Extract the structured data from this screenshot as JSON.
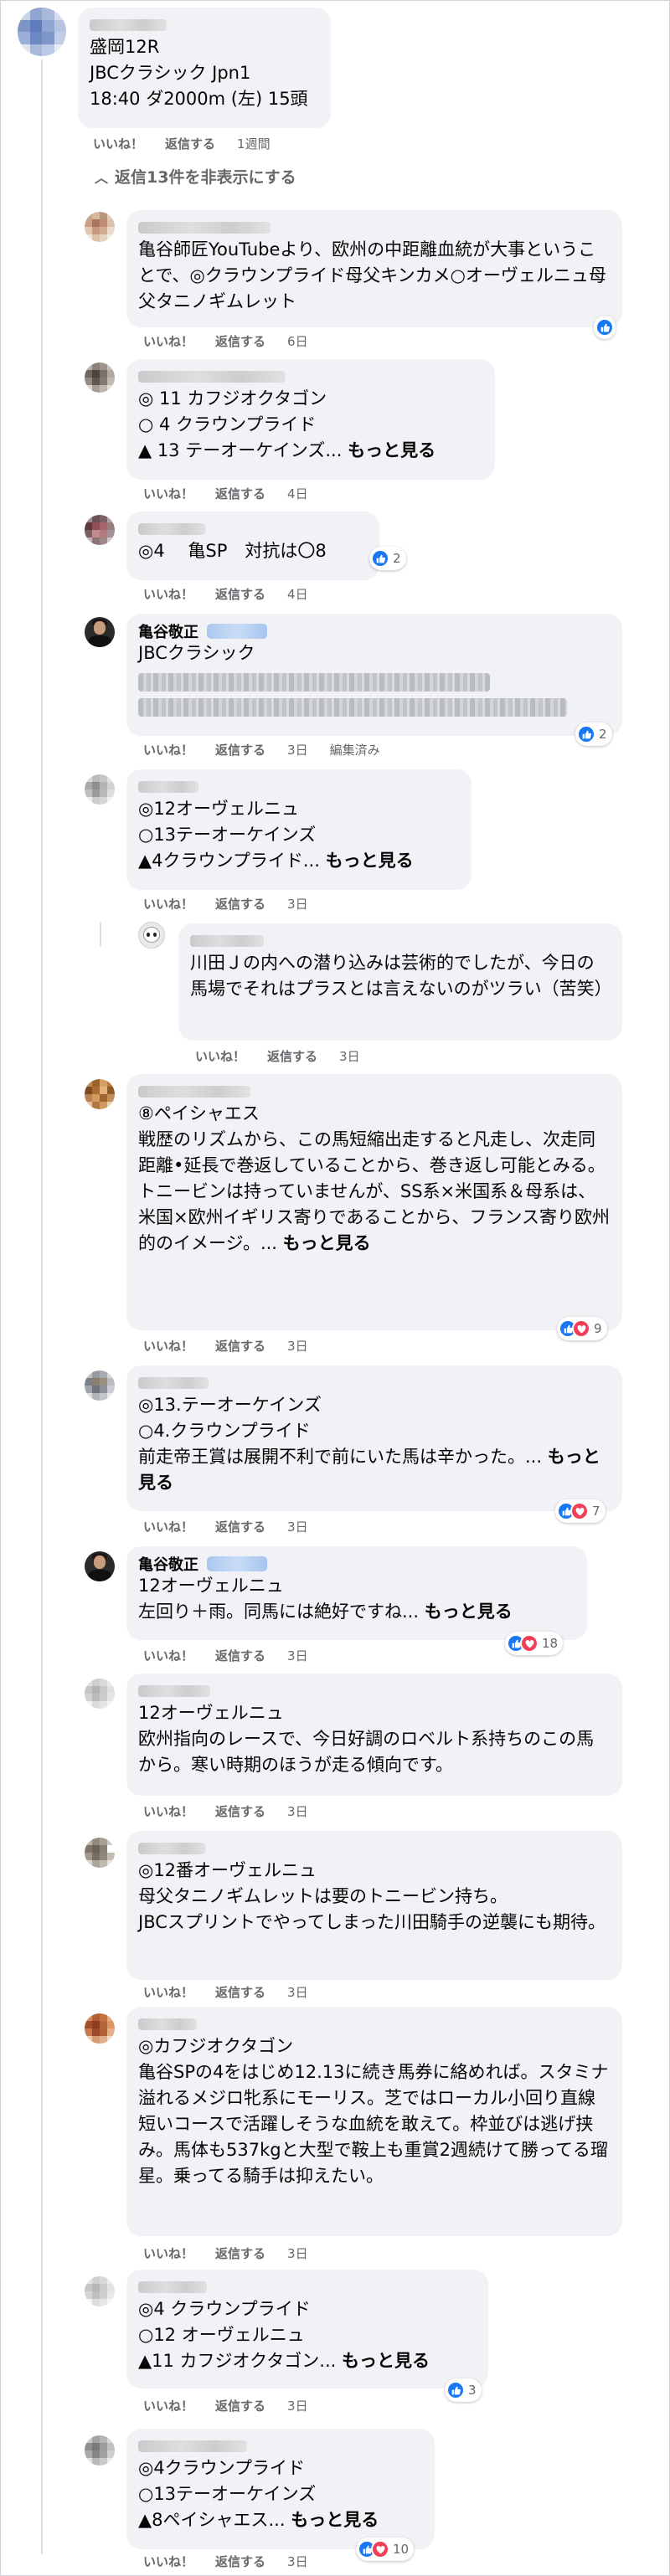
{
  "post": {
    "author": "",
    "lines": [
      "盛岡12R",
      "JBCクラシック Jpn1",
      "18:40 ダ2000m (左) 15頭"
    ],
    "actions": {
      "like": "いいね！",
      "reply": "返信する",
      "time": "1週間"
    }
  },
  "toggle": {
    "label": "返信13件を非表示にする"
  },
  "replies": [
    {
      "author": "",
      "text": "亀谷師匠YouTubeより、欧州の中距離血統が大事ということで、◎クラウンプライド母父キンカメ○オーヴェルニュ母父タニノギムレット",
      "more": "",
      "time": "6日",
      "reaction_count": "",
      "reactions": [
        "like"
      ]
    },
    {
      "author": "",
      "text": "◎ 11 カフジオクタゴン\n○ 4 クラウンプライド\n▲ 13 テーオーケインズ... ",
      "more": "もっと見る",
      "time": "4日",
      "reaction_count": "",
      "reactions": []
    },
    {
      "author": "",
      "text": "◎4　 亀SP　対抗は〇8",
      "more": "",
      "time": "4日",
      "reaction_count": "2",
      "reactions": [
        "like"
      ]
    },
    {
      "author": "亀谷敬正",
      "text": "JBCクラシック",
      "more": "",
      "time": "3日",
      "edited": "編集済み",
      "reaction_count": "2",
      "reactions": [
        "like"
      ]
    },
    {
      "author": "",
      "text": "◎12オーヴェルニュ\n○13テーオーケインズ\n▲4クラウンプライド... ",
      "more": "もっと見る",
      "time": "3日",
      "reaction_count": "",
      "reactions": []
    },
    {
      "author": "",
      "text": "川田Ｊの内への潜り込みは芸術的でしたが、今日の馬場でそれはプラスとは言えないのがツラい（苦笑）",
      "more": "",
      "time": "3日",
      "reaction_count": "",
      "reactions": []
    },
    {
      "author": "",
      "text": "⑧ペイシャエス\n戦歴のリズムから、この馬短縮出走すると凡走し、次走同距離•延長で巻返していることから、巻き返し可能とみる。\nトニービンは持っていませんが、SS系×米国系＆母系は、米国×欧州イギリス寄りであることから、フランス寄り欧州的のイメージ。... ",
      "more": "もっと見る",
      "time": "3日",
      "reaction_count": "9",
      "reactions": [
        "like",
        "love"
      ]
    },
    {
      "author": "",
      "text": "◎13.テーオーケインズ\n○4.クラウンプライド\n前走帝王賞は展開不利で前にいた馬は辛かった。... ",
      "more": "もっと見る",
      "time": "3日",
      "reaction_count": "7",
      "reactions": [
        "like",
        "love"
      ]
    },
    {
      "author": "亀谷敬正",
      "text": "12オーヴェルニュ\n左回り＋雨。同馬には絶好ですね... ",
      "more": "もっと見る",
      "time": "3日",
      "reaction_count": "18",
      "reactions": [
        "like",
        "love"
      ]
    },
    {
      "author": "",
      "text": "12オーヴェルニュ\n欧州指向のレースで、今日好調のロベルト系持ちのこの馬から。寒い時期のほうが走る傾向です。",
      "more": "",
      "time": "3日",
      "reaction_count": "",
      "reactions": []
    },
    {
      "author": "",
      "text": "◎12番オーヴェルニュ\n母父タニノギムレットは要のトニービン持ち。\nJBCスプリントでやってしまった川田騎手の逆襲にも期待。",
      "more": "",
      "time": "3日",
      "reaction_count": "",
      "reactions": []
    },
    {
      "author": "",
      "text": "◎カフジオクタゴン\n亀谷SPの4をはじめ12.13に続き馬券に絡めれば。スタミナ溢れるメジロ牝系にモーリス。芝ではローカル小回り直線短いコースで活躍しそうな血統を敢えて。枠並びは逃げ挟み。馬体も537kgと大型で鞍上も重賞2週続けて勝ってる瑠星。乗ってる騎手は抑えたい。",
      "more": "",
      "time": "3日",
      "reaction_count": "",
      "reactions": []
    },
    {
      "author": "",
      "text": "◎4 クラウンプライド\n○12 オーヴェルニュ\n▲11 カフジオクタゴン... ",
      "more": "もっと見る",
      "time": "3日",
      "reaction_count": "3",
      "reactions": [
        "like"
      ]
    },
    {
      "author": "",
      "text": "◎4クラウンプライド\n○13テーオーケインズ\n▲8ペイシャエス... ",
      "more": "もっと見る",
      "time": "3日",
      "reaction_count": "10",
      "reactions": [
        "like",
        "love"
      ]
    }
  ],
  "labels": {
    "like": "いいね！",
    "reply": "返信する"
  },
  "colors": {
    "like": "#1877f2",
    "love": "#f33e58",
    "bubble": "#f0f2f5",
    "meta": "#65676b"
  }
}
